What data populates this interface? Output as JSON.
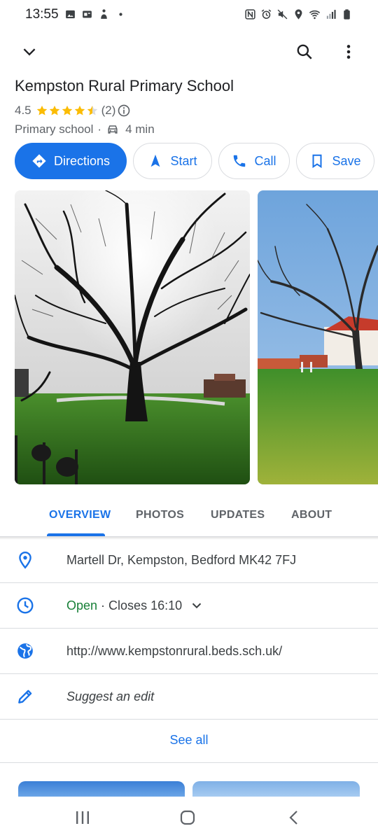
{
  "status_bar": {
    "time": "13:55",
    "left_icons": [
      "gallery-icon",
      "cast-icon",
      "figure-icon",
      "dot-icon"
    ],
    "right_icons": [
      "nfc-icon",
      "alarm-icon",
      "mute-icon",
      "location-icon",
      "wifi-icon",
      "signal-icon",
      "battery-icon"
    ]
  },
  "top_bar": {
    "collapse_icon": "chevron-down-icon",
    "search_icon": "search-icon",
    "more_icon": "more-vert-icon"
  },
  "place": {
    "title": "Kempston Rural Primary School",
    "rating": "4.5",
    "stars_value": 4.5,
    "review_count": "(2)",
    "category": "Primary school",
    "separator": "·",
    "drive_time": "4 min"
  },
  "actions": {
    "directions": "Directions",
    "start": "Start",
    "call": "Call",
    "save": "Save"
  },
  "tabs": [
    "OVERVIEW",
    "PHOTOS",
    "UPDATES",
    "ABOUT"
  ],
  "info": {
    "address": "Martell Dr, Kempston, Bedford MK42 7FJ",
    "hours_status": "Open",
    "hours_separator": " · ",
    "hours_detail": "Closes 16:10",
    "website": "http://www.kempstonrural.beds.sch.uk/",
    "suggest_edit": "Suggest an edit",
    "see_all": "See all"
  },
  "colors": {
    "accent": "#1a73e8",
    "open_green": "#188038",
    "star": "#fbbc04",
    "text_primary": "#202124",
    "text_secondary": "#5f6368",
    "divider": "#dadce0"
  },
  "nav_bar": {
    "recents": "recents-icon",
    "home": "home-icon",
    "back": "back-icon"
  }
}
